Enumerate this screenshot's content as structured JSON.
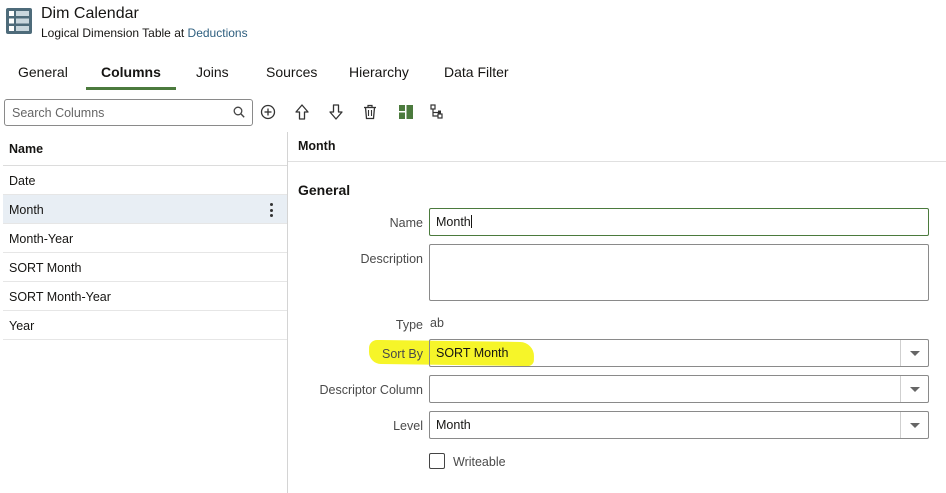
{
  "header": {
    "title": "Dim Calendar",
    "subtitle_prefix": "Logical Dimension Table at",
    "subtitle_link": "Deductions",
    "icon": "table-icon"
  },
  "tabs": [
    {
      "label": "General",
      "active": false
    },
    {
      "label": "Columns",
      "active": true
    },
    {
      "label": "Joins",
      "active": false
    },
    {
      "label": "Sources",
      "active": false
    },
    {
      "label": "Hierarchy",
      "active": false
    },
    {
      "label": "Data Filter",
      "active": false
    }
  ],
  "search": {
    "placeholder": "Search Columns",
    "icon": "search-icon"
  },
  "toolbar": {
    "buttons": [
      "add-icon",
      "move-up-icon",
      "move-down-icon",
      "delete-icon",
      "columns-view-icon",
      "hierarchy-icon"
    ],
    "accent": "#4b7a3d"
  },
  "columns_list": {
    "header": "Name",
    "rows": [
      {
        "label": "Date",
        "selected": false
      },
      {
        "label": "Month",
        "selected": true
      },
      {
        "label": "Month-Year",
        "selected": false
      },
      {
        "label": "SORT Month",
        "selected": false
      },
      {
        "label": "SORT Month-Year",
        "selected": false
      },
      {
        "label": "Year",
        "selected": false
      }
    ]
  },
  "detail": {
    "title": "Month",
    "section": "General",
    "fields": {
      "name": {
        "label": "Name",
        "value": "Month"
      },
      "description": {
        "label": "Description",
        "value": ""
      },
      "type": {
        "label": "Type",
        "value": "ab"
      },
      "sort_by": {
        "label": "Sort By",
        "value": "SORT Month"
      },
      "descriptor_column": {
        "label": "Descriptor Column",
        "value": ""
      },
      "level": {
        "label": "Level",
        "value": "Month"
      },
      "writeable": {
        "label": "Writeable",
        "checked": false
      }
    }
  },
  "colors": {
    "highlight": "#f6f41d",
    "selected_row": "#e8eef4",
    "link": "#2e5f7f",
    "active_tab_underline": "#4b7a3d"
  }
}
